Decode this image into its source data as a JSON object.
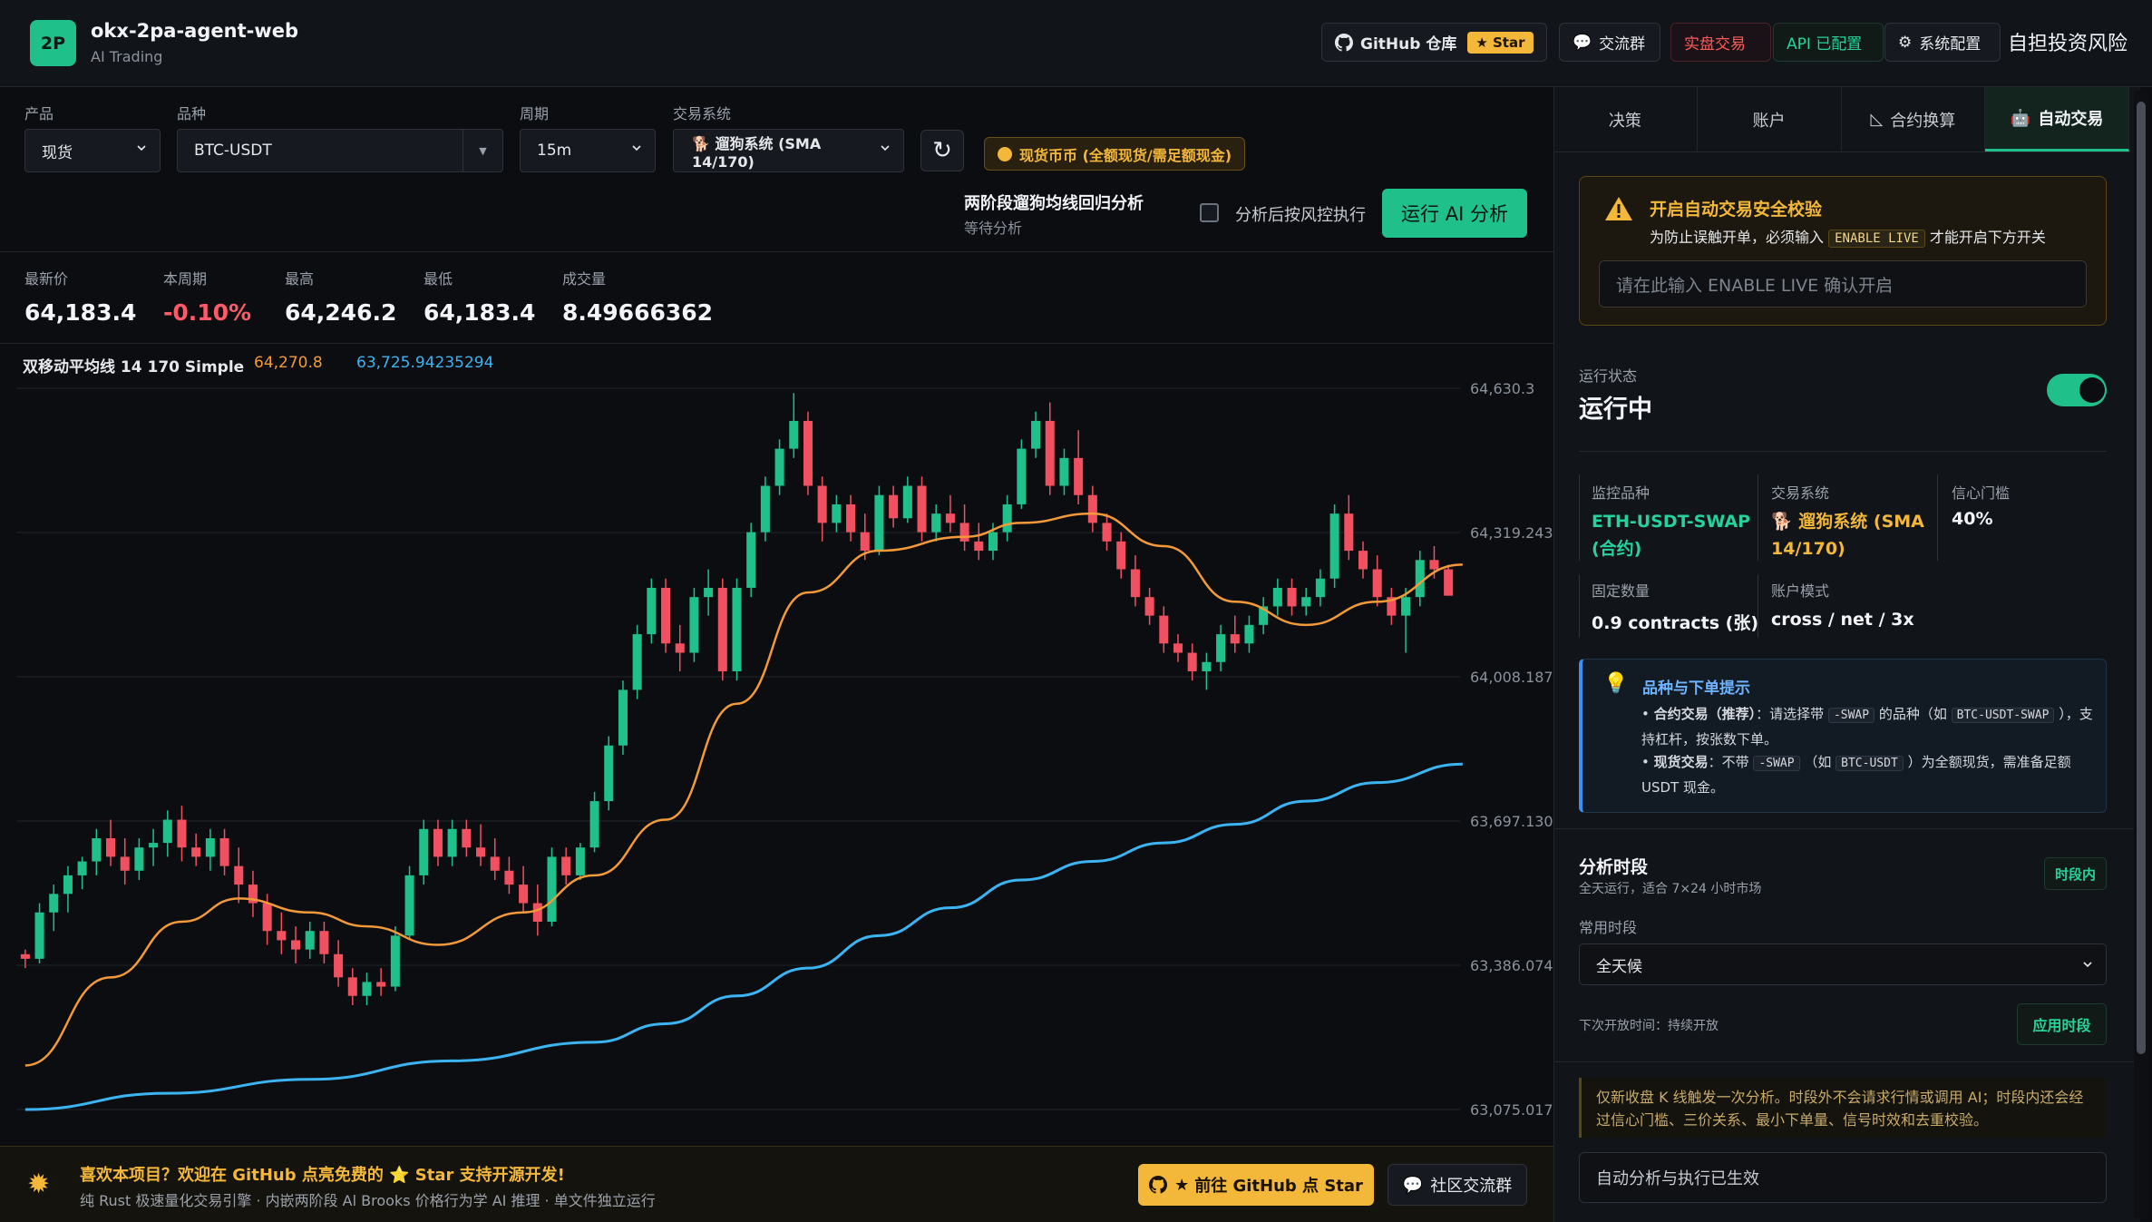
{
  "header": {
    "logo_text": "2P",
    "title": "okx-2pa-agent-web",
    "subtitle": "AI Trading",
    "github_label": "GitHub 仓库",
    "star_label": "Star",
    "community_label": "交流群",
    "live_label": "实盘交易",
    "api_label": "API 已配置",
    "settings_label": "系统配置",
    "risk_label": "自担投资风险"
  },
  "controls": {
    "product_label": "产品",
    "product_value": "现货",
    "symbol_label": "品种",
    "symbol_value": "BTC-USDT",
    "period_label": "周期",
    "period_value": "15m",
    "system_label": "交易系统",
    "system_value": "🐕 遛狗系统 (SMA 14/170)",
    "spot_badge": "现货币币 (全额现货/需足额现金)",
    "analysis_title": "两阶段遛狗均线回归分析",
    "analysis_status": "等待分析",
    "risk_check_label": "分析后按风控执行",
    "run_button": "运行 AI 分析"
  },
  "stats": [
    {
      "label": "最新价",
      "value": "64,183.4"
    },
    {
      "label": "本周期",
      "value": "-0.10%"
    },
    {
      "label": "最高",
      "value": "64,246.2"
    },
    {
      "label": "最低",
      "value": "64,183.4"
    },
    {
      "label": "成交量",
      "value": "8.49666362"
    }
  ],
  "ma_legend": {
    "label": "双移动平均线 14 170 Simple",
    "fast": "64,270.8",
    "slow": "63,725.94235294"
  },
  "chart_data": {
    "type": "candlestick",
    "y_ticks": [
      "64,630.3",
      "64,319.24352",
      "64,008.18705",
      "63,697.13058",
      "63,386.07411",
      "63,075.01764"
    ],
    "ylim": [
      63075.01764,
      64630.3
    ],
    "colors": {
      "up": "#20c08a",
      "down": "#f0505f",
      "ma_fast": "#f29a3a",
      "ma_slow": "#3db4f2"
    },
    "candles": [
      [
        63410,
        63420,
        63380,
        63400
      ],
      [
        63400,
        63520,
        63390,
        63500
      ],
      [
        63500,
        63560,
        63460,
        63540
      ],
      [
        63540,
        63600,
        63500,
        63580
      ],
      [
        63580,
        63620,
        63550,
        63610
      ],
      [
        63610,
        63680,
        63580,
        63660
      ],
      [
        63660,
        63700,
        63600,
        63620
      ],
      [
        63620,
        63660,
        63560,
        63590
      ],
      [
        63590,
        63660,
        63570,
        63640
      ],
      [
        63640,
        63680,
        63600,
        63650
      ],
      [
        63650,
        63720,
        63620,
        63700
      ],
      [
        63700,
        63730,
        63610,
        63640
      ],
      [
        63640,
        63670,
        63600,
        63620
      ],
      [
        63620,
        63680,
        63590,
        63660
      ],
      [
        63660,
        63680,
        63580,
        63600
      ],
      [
        63600,
        63640,
        63520,
        63560
      ],
      [
        63560,
        63590,
        63490,
        63520
      ],
      [
        63520,
        63540,
        63430,
        63460
      ],
      [
        63460,
        63500,
        63410,
        63440
      ],
      [
        63440,
        63470,
        63390,
        63420
      ],
      [
        63420,
        63480,
        63400,
        63460
      ],
      [
        63460,
        63480,
        63390,
        63410
      ],
      [
        63410,
        63440,
        63340,
        63360
      ],
      [
        63360,
        63380,
        63300,
        63320
      ],
      [
        63320,
        63370,
        63300,
        63350
      ],
      [
        63350,
        63380,
        63320,
        63340
      ],
      [
        63340,
        63470,
        63330,
        63450
      ],
      [
        63450,
        63600,
        63440,
        63580
      ],
      [
        63580,
        63700,
        63560,
        63680
      ],
      [
        63680,
        63700,
        63600,
        63620
      ],
      [
        63620,
        63700,
        63600,
        63680
      ],
      [
        63680,
        63700,
        63620,
        63640
      ],
      [
        63640,
        63690,
        63600,
        63620
      ],
      [
        63620,
        63660,
        63570,
        63590
      ],
      [
        63590,
        63620,
        63540,
        63560
      ],
      [
        63560,
        63600,
        63500,
        63520
      ],
      [
        63520,
        63560,
        63450,
        63480
      ],
      [
        63480,
        63640,
        63470,
        63620
      ],
      [
        63620,
        63640,
        63560,
        63580
      ],
      [
        63580,
        63650,
        63570,
        63640
      ],
      [
        63640,
        63760,
        63630,
        63740
      ],
      [
        63740,
        63880,
        63720,
        63860
      ],
      [
        63860,
        64000,
        63840,
        63980
      ],
      [
        63980,
        64120,
        63960,
        64100
      ],
      [
        64100,
        64220,
        64080,
        64200
      ],
      [
        64200,
        64220,
        64060,
        64080
      ],
      [
        64080,
        64120,
        64020,
        64060
      ],
      [
        64060,
        64200,
        64040,
        64180
      ],
      [
        64180,
        64240,
        64140,
        64200
      ],
      [
        64200,
        64220,
        64000,
        64020
      ],
      [
        64020,
        64220,
        64000,
        64200
      ],
      [
        64200,
        64340,
        64180,
        64320
      ],
      [
        64320,
        64440,
        64300,
        64420
      ],
      [
        64420,
        64520,
        64400,
        64500
      ],
      [
        64500,
        64620,
        64480,
        64560
      ],
      [
        64560,
        64580,
        64400,
        64420
      ],
      [
        64420,
        64440,
        64300,
        64340
      ],
      [
        64340,
        64400,
        64320,
        64380
      ],
      [
        64380,
        64400,
        64300,
        64320
      ],
      [
        64320,
        64360,
        64260,
        64280
      ],
      [
        64280,
        64420,
        64270,
        64400
      ],
      [
        64400,
        64420,
        64330,
        64350
      ],
      [
        64350,
        64440,
        64340,
        64420
      ],
      [
        64420,
        64440,
        64300,
        64320
      ],
      [
        64320,
        64380,
        64300,
        64360
      ],
      [
        64360,
        64400,
        64320,
        64340
      ],
      [
        64340,
        64380,
        64280,
        64300
      ],
      [
        64300,
        64340,
        64260,
        64280
      ],
      [
        64280,
        64340,
        64260,
        64320
      ],
      [
        64320,
        64400,
        64300,
        64380
      ],
      [
        64380,
        64520,
        64370,
        64500
      ],
      [
        64500,
        64580,
        64480,
        64560
      ],
      [
        64560,
        64600,
        64400,
        64420
      ],
      [
        64420,
        64500,
        64400,
        64480
      ],
      [
        64480,
        64540,
        64380,
        64400
      ],
      [
        64400,
        64420,
        64320,
        64340
      ],
      [
        64340,
        64360,
        64280,
        64300
      ],
      [
        64300,
        64320,
        64220,
        64240
      ],
      [
        64240,
        64270,
        64160,
        64180
      ],
      [
        64180,
        64200,
        64120,
        64140
      ],
      [
        64140,
        64160,
        64060,
        64080
      ],
      [
        64080,
        64100,
        64040,
        64060
      ],
      [
        64060,
        64080,
        64000,
        64020
      ],
      [
        64020,
        64060,
        63980,
        64040
      ],
      [
        64040,
        64120,
        64020,
        64100
      ],
      [
        64100,
        64140,
        64060,
        64080
      ],
      [
        64080,
        64140,
        64060,
        64120
      ],
      [
        64120,
        64180,
        64100,
        64160
      ],
      [
        64160,
        64220,
        64140,
        64200
      ],
      [
        64200,
        64220,
        64140,
        64160
      ],
      [
        64160,
        64200,
        64140,
        64180
      ],
      [
        64180,
        64240,
        64160,
        64220
      ],
      [
        64220,
        64380,
        64200,
        64360
      ],
      [
        64360,
        64400,
        64260,
        64280
      ],
      [
        64280,
        64300,
        64220,
        64240
      ],
      [
        64240,
        64270,
        64160,
        64180
      ],
      [
        64180,
        64200,
        64120,
        64140
      ],
      [
        64140,
        64200,
        64060,
        64180
      ],
      [
        64180,
        64280,
        64160,
        64260
      ],
      [
        64260,
        64290,
        64220,
        64240
      ],
      [
        64240,
        64250,
        64183,
        64183
      ]
    ],
    "ma_fast": [
      [
        0,
        63170
      ],
      [
        6,
        63360
      ],
      [
        11,
        63480
      ],
      [
        15,
        63530
      ],
      [
        20,
        63500
      ],
      [
        24,
        63470
      ],
      [
        29,
        63430
      ],
      [
        35,
        63500
      ],
      [
        40,
        63580
      ],
      [
        45,
        63700
      ],
      [
        50,
        63950
      ],
      [
        55,
        64190
      ],
      [
        60,
        64280
      ],
      [
        66,
        64310
      ],
      [
        70,
        64340
      ],
      [
        75,
        64360
      ],
      [
        80,
        64290
      ],
      [
        85,
        64170
      ],
      [
        90,
        64120
      ],
      [
        95,
        64170
      ],
      [
        101,
        64250
      ]
    ],
    "ma_slow": [
      [
        0,
        63075
      ],
      [
        10,
        63110
      ],
      [
        20,
        63140
      ],
      [
        30,
        63180
      ],
      [
        40,
        63220
      ],
      [
        45,
        63260
      ],
      [
        50,
        63320
      ],
      [
        55,
        63380
      ],
      [
        60,
        63450
      ],
      [
        65,
        63510
      ],
      [
        70,
        63570
      ],
      [
        75,
        63610
      ],
      [
        80,
        63650
      ],
      [
        85,
        63690
      ],
      [
        90,
        63740
      ],
      [
        95,
        63780
      ],
      [
        101,
        63820
      ]
    ]
  },
  "footer": {
    "title": "喜欢本项目？欢迎在 GitHub 点亮免费的 ⭐ Star 支持开源开发!",
    "subtitle": "纯 Rust 极速量化交易引擎 · 内嵌两阶段 Al Brooks 价格行为学 AI 推理 · 单文件独立运行",
    "github_button": "前往 GitHub 点 Star",
    "community_button": "社区交流群"
  },
  "side": {
    "tabs": [
      "决策",
      "账户",
      "合约换算",
      "自动交易"
    ],
    "warn_title": "开启自动交易安全校验",
    "warn_desc_pre": "为防止误触开单，必须输入",
    "warn_code": "ENABLE LIVE",
    "warn_desc_post": "才能开启下方开关",
    "warn_placeholder": "请在此输入 ENABLE LIVE 确认开启",
    "status_label": "运行状态",
    "status_value": "运行中",
    "monitor_label": "监控品种",
    "monitor_value": "ETH-USDT-SWAP (合约)",
    "system_label": "交易系统",
    "system_value": "🐕 遛狗系统 (SMA 14/170)",
    "confidence_label": "信心门槛",
    "confidence_value": "40%",
    "qty_label": "固定数量",
    "qty_value": "0.9 contracts (张)",
    "mode_label": "账户模式",
    "mode_value": "cross / net / 3x",
    "tip_title": "品种与下单提示",
    "tip1_bold": "合约交易（推荐）",
    "tip1_a": "：请选择带",
    "tip1_code1": "-SWAP",
    "tip1_b": "的品种（如",
    "tip1_code2": "BTC-USDT-SWAP",
    "tip1_c": "），支持杠杆，按张数下单。",
    "tip2_bold": "现货交易",
    "tip2_a": "：不带",
    "tip2_code1": "-SWAP",
    "tip2_b": "（如",
    "tip2_code2": "BTC-USDT",
    "tip2_c": "）为全额现货，需准备足额 USDT 现金。",
    "period_title": "分析时段",
    "period_sub": "全天运行，适合 7×24 小时市场",
    "period_badge": "时段内",
    "common_label": "常用时段",
    "common_value": "全天候",
    "next_open": "下次开放时间：持续开放",
    "apply_button": "应用时段",
    "note": "仅新收盘 K 线触发一次分析。时段外不会请求行情或调用 AI；时段内还会经过信心门槛、三价关系、最小下单量、信号时效和去重校验。",
    "auto_status": "自动分析与执行已生效"
  }
}
